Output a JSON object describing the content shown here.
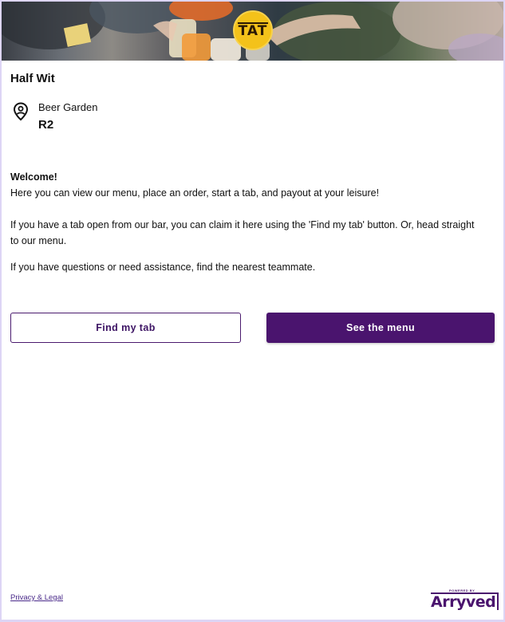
{
  "venue": {
    "name": "Half Wit",
    "area": "Beer Garden",
    "table": "R2"
  },
  "hero": {
    "badge_text": "TAT"
  },
  "welcome": {
    "heading": "Welcome!",
    "intro": "Here you can view our menu, place an order, start a tab, and payout at your leisure!",
    "claim": "If you have a tab open from our bar, you can claim it here using the 'Find my tab' button. Or, head straight to our menu.",
    "help": "If you have questions or need assistance, find the nearest teammate."
  },
  "actions": {
    "find_tab_label": "Find my tab",
    "see_menu_label": "See the menu"
  },
  "footer": {
    "privacy_label": "Privacy & Legal",
    "powered_by": "POWERED BY",
    "brand": "Arryved"
  },
  "colors": {
    "brand_purple": "#4a146e",
    "badge_yellow": "#f4c21a",
    "page_border": "#ddd5f5"
  },
  "icons": {
    "location": "location-pin-icon"
  }
}
